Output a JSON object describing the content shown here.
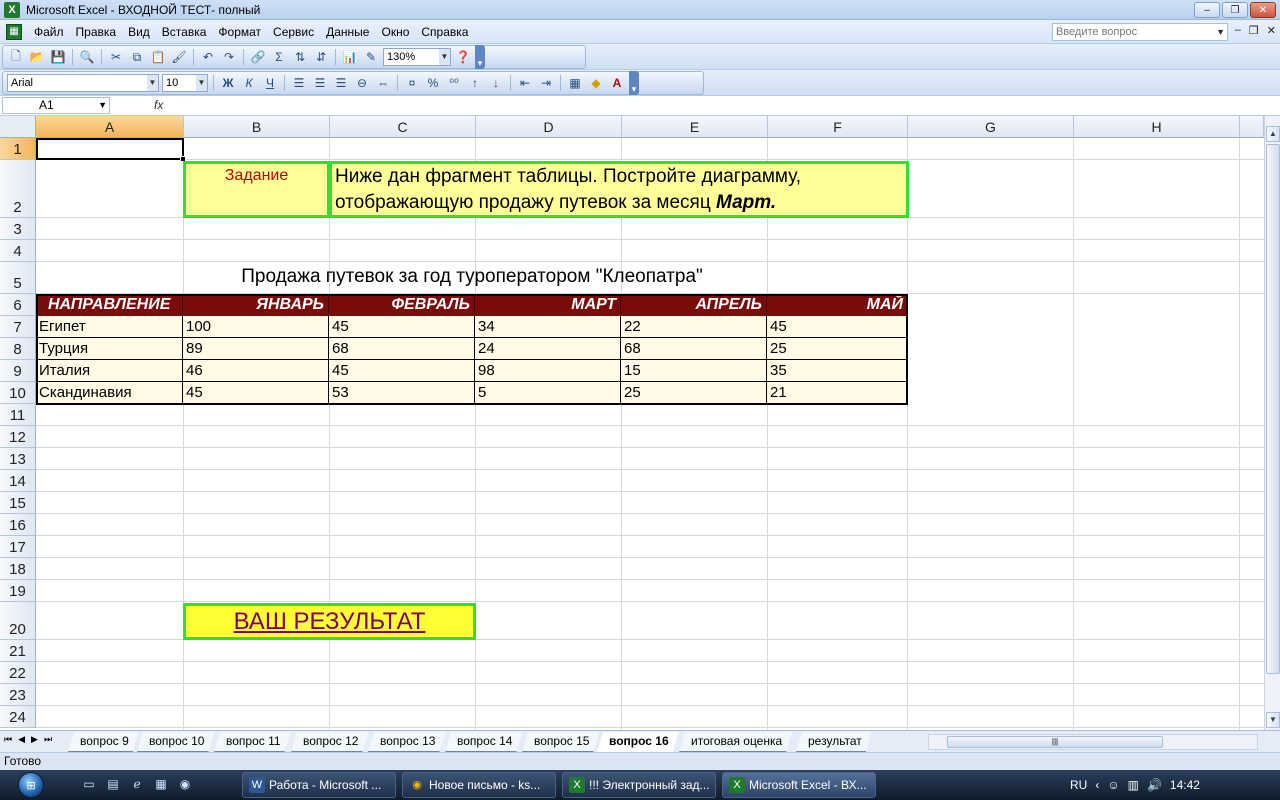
{
  "window": {
    "title": "Microsoft Excel - ВХОДНОЙ ТЕСТ- полный",
    "btn_min": "‒",
    "btn_max": "❐",
    "btn_close": "✕"
  },
  "menu": {
    "items": [
      "Файл",
      "Правка",
      "Вид",
      "Вставка",
      "Формат",
      "Сервис",
      "Данные",
      "Окно",
      "Справка"
    ],
    "ask_placeholder": "Введите вопрос"
  },
  "toolbar": {
    "zoom": "130%",
    "font": "Arial",
    "size": "10"
  },
  "formula_bar": {
    "name_box": "A1",
    "fx": "fx",
    "content": ""
  },
  "columns": [
    "A",
    "B",
    "C",
    "D",
    "E",
    "F",
    "G",
    "H"
  ],
  "rows": [
    "1",
    "2",
    "3",
    "4",
    "5",
    "6",
    "7",
    "8",
    "9",
    "10",
    "11",
    "12",
    "13",
    "14",
    "15",
    "16",
    "17",
    "18",
    "19",
    "20",
    "21",
    "22",
    "23",
    "24"
  ],
  "task": {
    "label": "Задание",
    "text": "Ниже дан фрагмент таблицы. Постройте диаграмму, отображающую продажу путевок за месяц",
    "month": "Март."
  },
  "table": {
    "title": "Продажа путевок за год туроператором \"Клеопатра\"",
    "headers": [
      "НАПРАВЛЕНИЕ",
      "ЯНВАРЬ",
      "ФЕВРАЛЬ",
      "МАРТ",
      "АПРЕЛЬ",
      "МАЙ"
    ],
    "rows": [
      [
        "Египет",
        "100",
        "45",
        "34",
        "22",
        "45"
      ],
      [
        "Турция",
        "89",
        "68",
        "24",
        "68",
        "25"
      ],
      [
        "Италия",
        "46",
        "45",
        "98",
        "15",
        "35"
      ],
      [
        "Скандинавия",
        "45",
        "53",
        "5",
        "25",
        "21"
      ]
    ]
  },
  "result_button": "ВАШ РЕЗУЛЬТАТ",
  "sheets": [
    "вопрос 9",
    "вопрос 10",
    "вопрос 11",
    "вопрос 12",
    "вопрос 13",
    "вопрос 14",
    "вопрос 15",
    "вопрос 16",
    "итоговая оценка",
    "результат"
  ],
  "active_sheet": "вопрос 16",
  "status": "Готово",
  "taskbar": {
    "buttons": [
      "Работа - Microsoft ...",
      "Новое письмо - ks...",
      "!!! Электронный зад...",
      "Microsoft Excel - ВХ..."
    ],
    "lang": "RU",
    "time": "14:42"
  },
  "colors": {
    "header_bg": "#7b0b0b",
    "highlight_fill": "#ffff99",
    "green_border": "#33dd33",
    "task_label_color": "#c00000"
  }
}
